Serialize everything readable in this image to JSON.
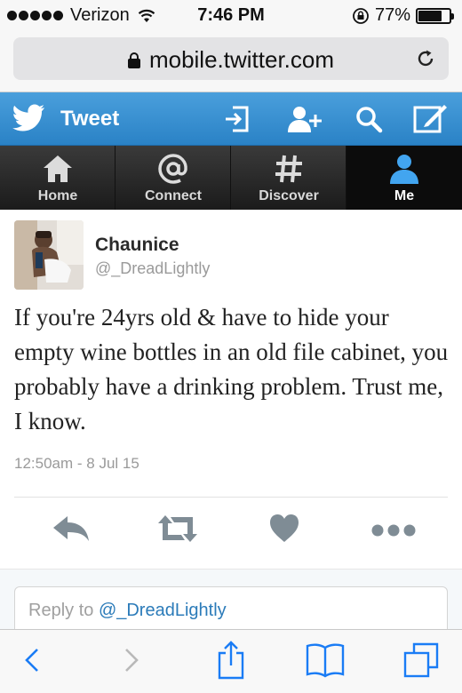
{
  "status_bar": {
    "carrier": "Verizon",
    "time": "7:46 PM",
    "battery_percent": "77%",
    "battery_level": 0.77,
    "wifi_icon": "wifi-icon",
    "rotation_lock_icon": "rotation-lock-icon"
  },
  "browser": {
    "url": "mobile.twitter.com",
    "lock_icon": "lock-icon",
    "reload_icon": "reload-icon"
  },
  "header": {
    "title": "Tweet",
    "brand_color": "#2f8bd0",
    "icons": [
      "sign-in-icon",
      "add-user-icon",
      "search-icon",
      "compose-icon"
    ]
  },
  "nav": {
    "items": [
      {
        "label": "Home",
        "icon": "home-icon"
      },
      {
        "label": "Connect",
        "icon": "at-icon"
      },
      {
        "label": "Discover",
        "icon": "hash-icon"
      },
      {
        "label": "Me",
        "icon": "person-icon",
        "active": true
      }
    ]
  },
  "tweet": {
    "author_name": "Chaunice",
    "author_handle": "@_DreadLightly",
    "text": "If you're 24yrs old & have to hide your empty wine bottles in an old file cabinet, you probably have a drinking problem. Trust me, I know.",
    "timestamp": "12:50am - 8 Jul 15",
    "actions": [
      "reply-icon",
      "retweet-icon",
      "favorite-icon",
      "more-icon"
    ]
  },
  "reply": {
    "prefix": "Reply to",
    "handle": "@_DreadLightly"
  },
  "toolbar": {
    "icons": [
      "back-icon",
      "forward-icon",
      "share-icon",
      "bookmarks-icon",
      "tabs-icon"
    ],
    "accent_color": "#1a7cf5"
  }
}
